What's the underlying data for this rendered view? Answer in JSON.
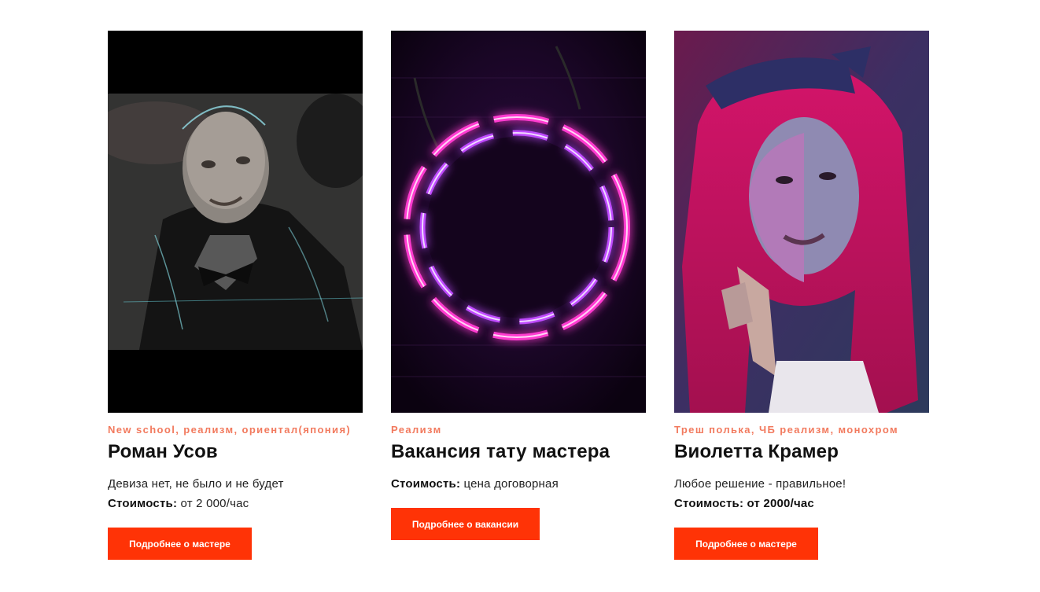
{
  "cards": [
    {
      "tags": "New school, реализм, ориентал(япония)",
      "name": "Роман Усов",
      "motto": "Девиза нет, не было и не будет",
      "price_label": "Стоимость:",
      "price_value": "от 2 000/час",
      "button_label": "Подробнее о мастере"
    },
    {
      "tags": "Реализм",
      "name": "Вакансия тату мастера",
      "price_label": "Стоимость:",
      "price_value": "цена договорная",
      "button_label": "Подробнее о вакансии"
    },
    {
      "tags": "Треш полька, ЧБ реализм, монохром",
      "name": "Виолетта Крамер",
      "motto": "Любое решение - правильное!",
      "price_label": "Стоимость:",
      "price_value": "от 2000/час",
      "button_label": "Подробнее о мастере"
    }
  ],
  "colors": {
    "accent": "#ff3306",
    "tags": "#f27a5e",
    "text": "#111111"
  }
}
